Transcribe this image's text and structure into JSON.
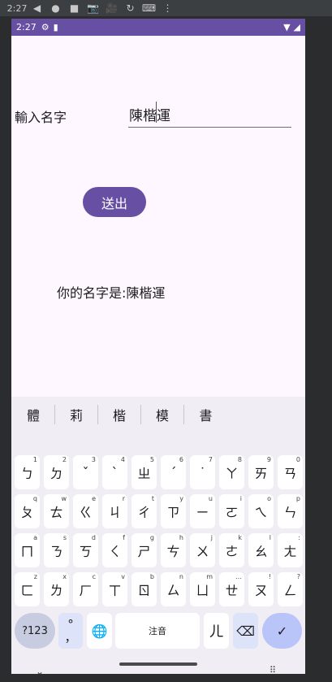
{
  "emulator_bar": {
    "time": "2:27",
    "icons": [
      "◀",
      "●",
      "■",
      "📷",
      "🎥",
      "↻",
      "⌨",
      "⋮"
    ]
  },
  "statusbar": {
    "time": "2:27",
    "icons": [
      "⚙",
      "▮"
    ],
    "right_icons": [
      "▼",
      "◢"
    ]
  },
  "form": {
    "label": "輸入名字",
    "input_value": "陳楷運",
    "submit_label": "送出",
    "result_text": "你的名字是:陳楷運"
  },
  "keyboard": {
    "suggestions": [
      "體",
      "莉",
      "楷",
      "模",
      "書"
    ],
    "row1": [
      {
        "k": "ㄅ",
        "h": "1"
      },
      {
        "k": "ㄉ",
        "h": "2"
      },
      {
        "k": "ˇ",
        "h": "3"
      },
      {
        "k": "ˋ",
        "h": "4"
      },
      {
        "k": "ㄓ",
        "h": "5"
      },
      {
        "k": "ˊ",
        "h": "6"
      },
      {
        "k": "˙",
        "h": "7"
      },
      {
        "k": "ㄚ",
        "h": "8"
      },
      {
        "k": "ㄞ",
        "h": "9"
      },
      {
        "k": "ㄢ",
        "h": "0"
      }
    ],
    "row2": [
      {
        "k": "ㄆ",
        "h": "q"
      },
      {
        "k": "ㄊ",
        "h": "w"
      },
      {
        "k": "ㄍ",
        "h": "e"
      },
      {
        "k": "ㄐ",
        "h": "r"
      },
      {
        "k": "ㄔ",
        "h": "t"
      },
      {
        "k": "ㄗ",
        "h": "y"
      },
      {
        "k": "ㄧ",
        "h": "u"
      },
      {
        "k": "ㄛ",
        "h": "i"
      },
      {
        "k": "ㄟ",
        "h": "o"
      },
      {
        "k": "ㄣ",
        "h": "p"
      }
    ],
    "row3": [
      {
        "k": "ㄇ",
        "h": "a"
      },
      {
        "k": "ㄋ",
        "h": "s"
      },
      {
        "k": "ㄎ",
        "h": "d"
      },
      {
        "k": "ㄑ",
        "h": "f"
      },
      {
        "k": "ㄕ",
        "h": "g"
      },
      {
        "k": "ㄘ",
        "h": "h"
      },
      {
        "k": "ㄨ",
        "h": "j"
      },
      {
        "k": "ㄜ",
        "h": "k"
      },
      {
        "k": "ㄠ",
        "h": "l"
      },
      {
        "k": "ㄤ",
        "h": ":"
      }
    ],
    "row4": [
      {
        "k": "ㄈ",
        "h": "z"
      },
      {
        "k": "ㄌ",
        "h": "x"
      },
      {
        "k": "ㄏ",
        "h": "c"
      },
      {
        "k": "ㄒ",
        "h": "v"
      },
      {
        "k": "ㄖ",
        "h": "b"
      },
      {
        "k": "ㄙ",
        "h": "n"
      },
      {
        "k": "ㄩ",
        "h": "m"
      },
      {
        "k": "ㄝ",
        "h": "…"
      },
      {
        "k": "ㄡ",
        "h": "!"
      },
      {
        "k": "ㄥ",
        "h": "?"
      }
    ],
    "mode_label": "?123",
    "punct_top": "°",
    "punct_bottom": "，",
    "globe": "🌐",
    "space_label": "注音",
    "er_key": "ㄦ",
    "delete_icon": "⌫",
    "enter_icon": "✓",
    "hide_icon": "⌄",
    "grid_icon": "⠿"
  },
  "colors": {
    "accent": "#6750a4",
    "background": "#fef7ff",
    "keyboard_bg": "#f0edf4"
  }
}
